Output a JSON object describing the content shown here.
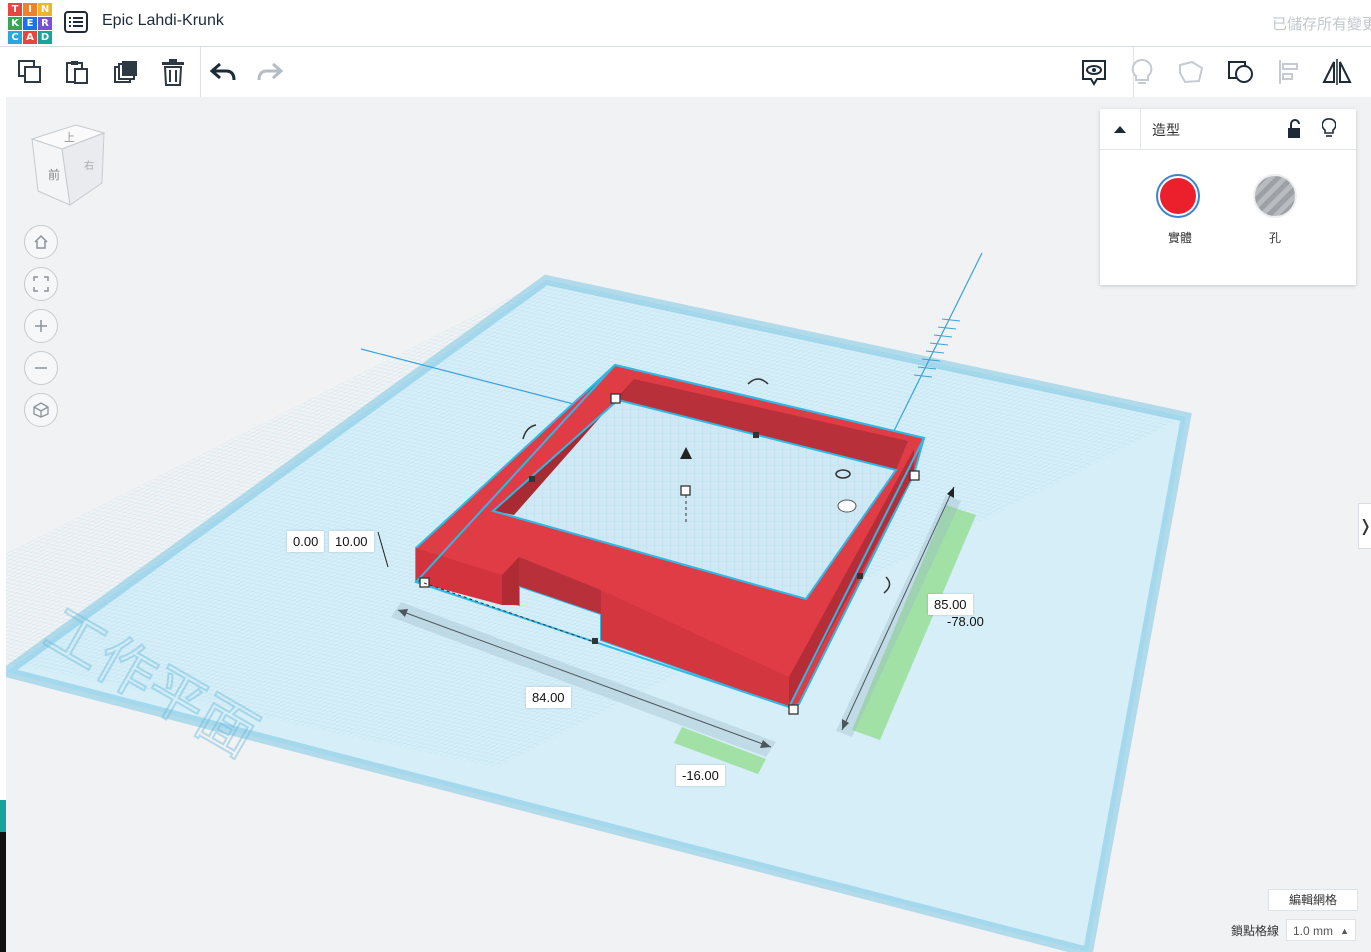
{
  "logo": {
    "letters": [
      "T",
      "I",
      "N",
      "K",
      "E",
      "R",
      "C",
      "A",
      "D"
    ],
    "colors": [
      "#e8453c",
      "#f2802a",
      "#f0b426",
      "#34a853",
      "#1a73e8",
      "#7a4fd1",
      "#29a8e0",
      "#e8453c",
      "#1aa39e"
    ]
  },
  "header": {
    "title": "Epic Lahdi-Krunk",
    "saved_status": "已儲存所有變更"
  },
  "toolbar": {
    "left_icons": [
      "copy-icon",
      "paste-icon",
      "duplicate-icon",
      "delete-icon",
      "undo-icon",
      "redo-icon"
    ],
    "right_icons": [
      "notes-icon",
      "lightbulb-icon",
      "group-icon",
      "ungroup-icon",
      "align-icon",
      "mirror-icon"
    ]
  },
  "viewcube": {
    "top": "上",
    "front": "前",
    "right": "右"
  },
  "nav": {
    "buttons": [
      "home-icon",
      "fit-icon",
      "zoom-in-icon",
      "zoom-out-icon",
      "perspective-icon"
    ]
  },
  "inspector": {
    "title": "造型",
    "solid_label": "實體",
    "hole_label": "孔",
    "solid_color": "#ec1f2d"
  },
  "workplane": {
    "label": "工作平面"
  },
  "dimensions": {
    "elevation": "0.00",
    "height": "10.00",
    "width": "84.00",
    "x_offset": "-16.00",
    "length": "85.00",
    "y_offset": "-78.00"
  },
  "footer": {
    "edit_grid": "編輯網格",
    "snap_label": "鎖點格線",
    "snap_value": "1.0 mm"
  }
}
